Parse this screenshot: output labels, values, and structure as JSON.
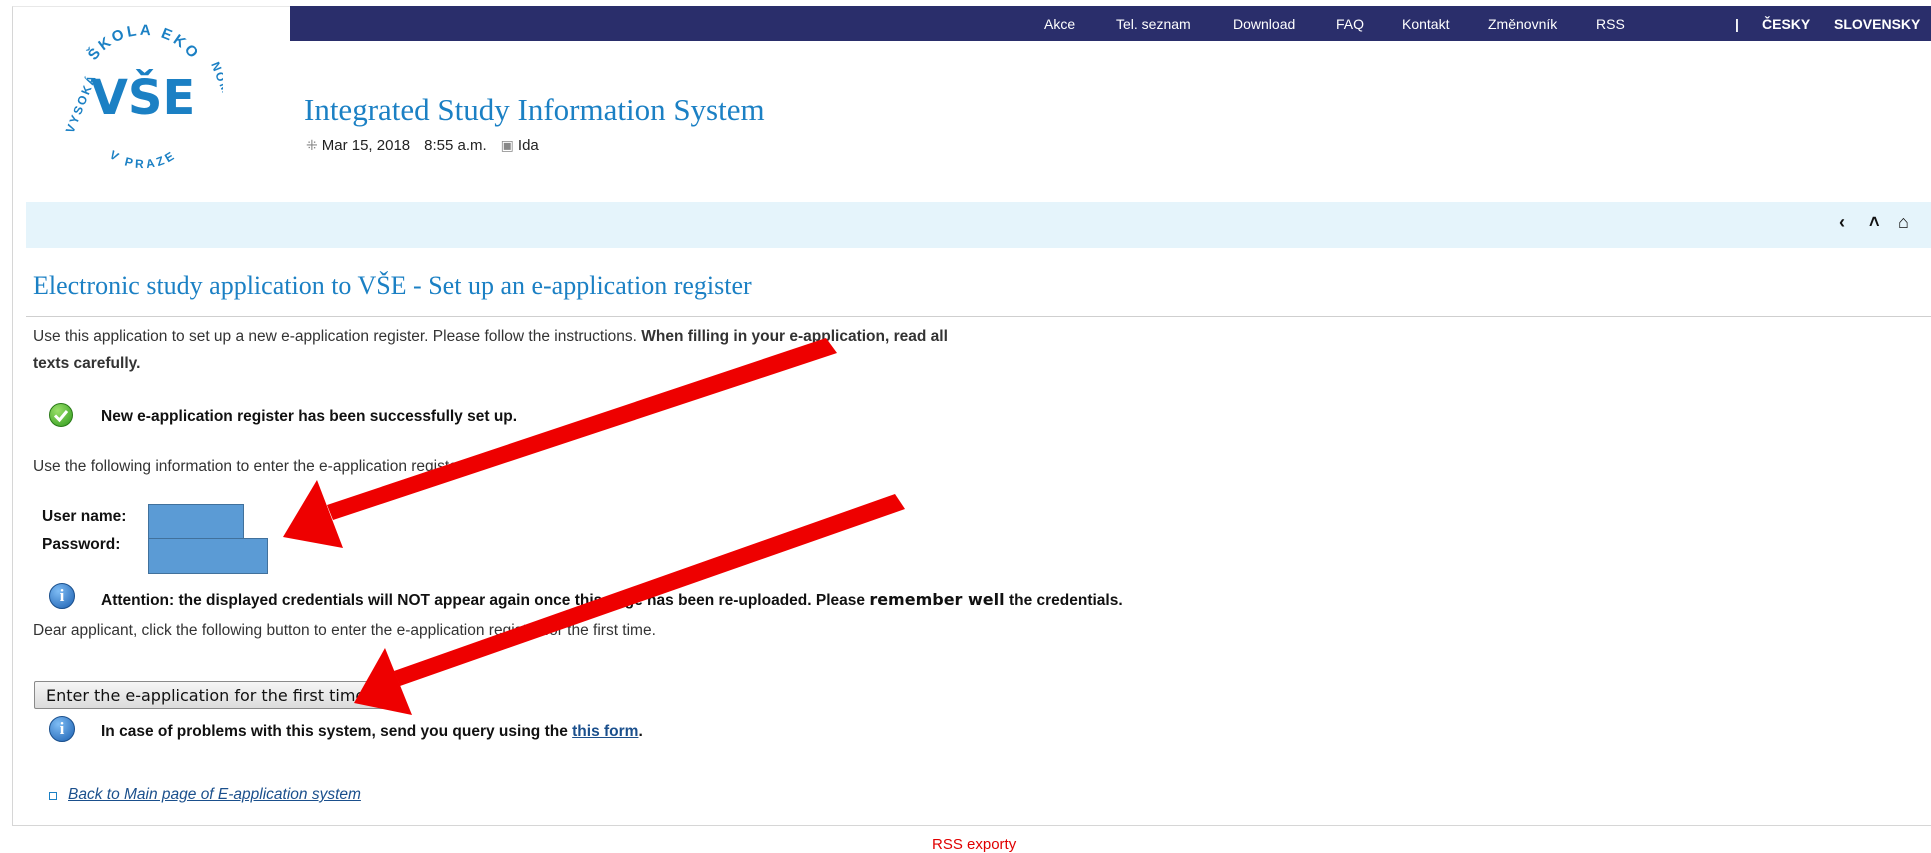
{
  "top_nav": {
    "links": [
      "Akce",
      "Tel. seznam",
      "Download",
      "FAQ",
      "Kontakt",
      "Změnovník",
      "RSS"
    ],
    "separator": "|",
    "languages": [
      "ČESKY",
      "SLOVENSKY"
    ]
  },
  "logo": {
    "arc_top": "ŠKOLA EKO",
    "arc_left": "VYSOKÁ",
    "arc_right": "NOMICKÁ",
    "arc_bottom": "V PRAZE",
    "mark": "VŠE"
  },
  "header": {
    "title": "Integrated Study Information System",
    "date": "Mar 15, 2018",
    "time": "8:55 a.m.",
    "nameday": "Ida",
    "date_icon": "clock-icon",
    "nameday_icon": "calendar-icon"
  },
  "nav_buttons": {
    "back": "‹",
    "up": "˄",
    "home": "⌂"
  },
  "page": {
    "title": "Electronic study application to VŠE - Set up an e-application register",
    "intro_plain": "Use this application to set up a new e-application register. Please follow the instructions.",
    "intro_bold_1": "When filling in your e-application, read all",
    "intro_bold_2": "texts carefully.",
    "success_message": "New e-application register has been successfully set up.",
    "use_info": "Use the following information to enter the e-application register:",
    "username_label": "User name:",
    "password_label": "Password:",
    "attention_1": "Attention: the displayed credentials will NOT appear again once this page has been re-uploaded. Please",
    "attention_strong": "remember well",
    "attention_2": "the credentials.",
    "dear_applicant": "Dear applicant, click the following button to enter the e-application register for the first time.",
    "enter_button": "Enter the e-application for the first time",
    "problems_text": "In case of problems with this system, send you query using the",
    "problems_link": "this form",
    "problems_end": ".",
    "back_link": "Back to Main page of E-application system"
  },
  "footer": {
    "rss": "RSS exporty"
  },
  "colors": {
    "top_bar": "#2a2e6b",
    "accent_blue": "#1b80c4",
    "subbar": "#e5f4fb",
    "annotation_arrow": "#ee0000",
    "credential_mask": "#5b9bd5",
    "footer_red": "#e00000"
  }
}
